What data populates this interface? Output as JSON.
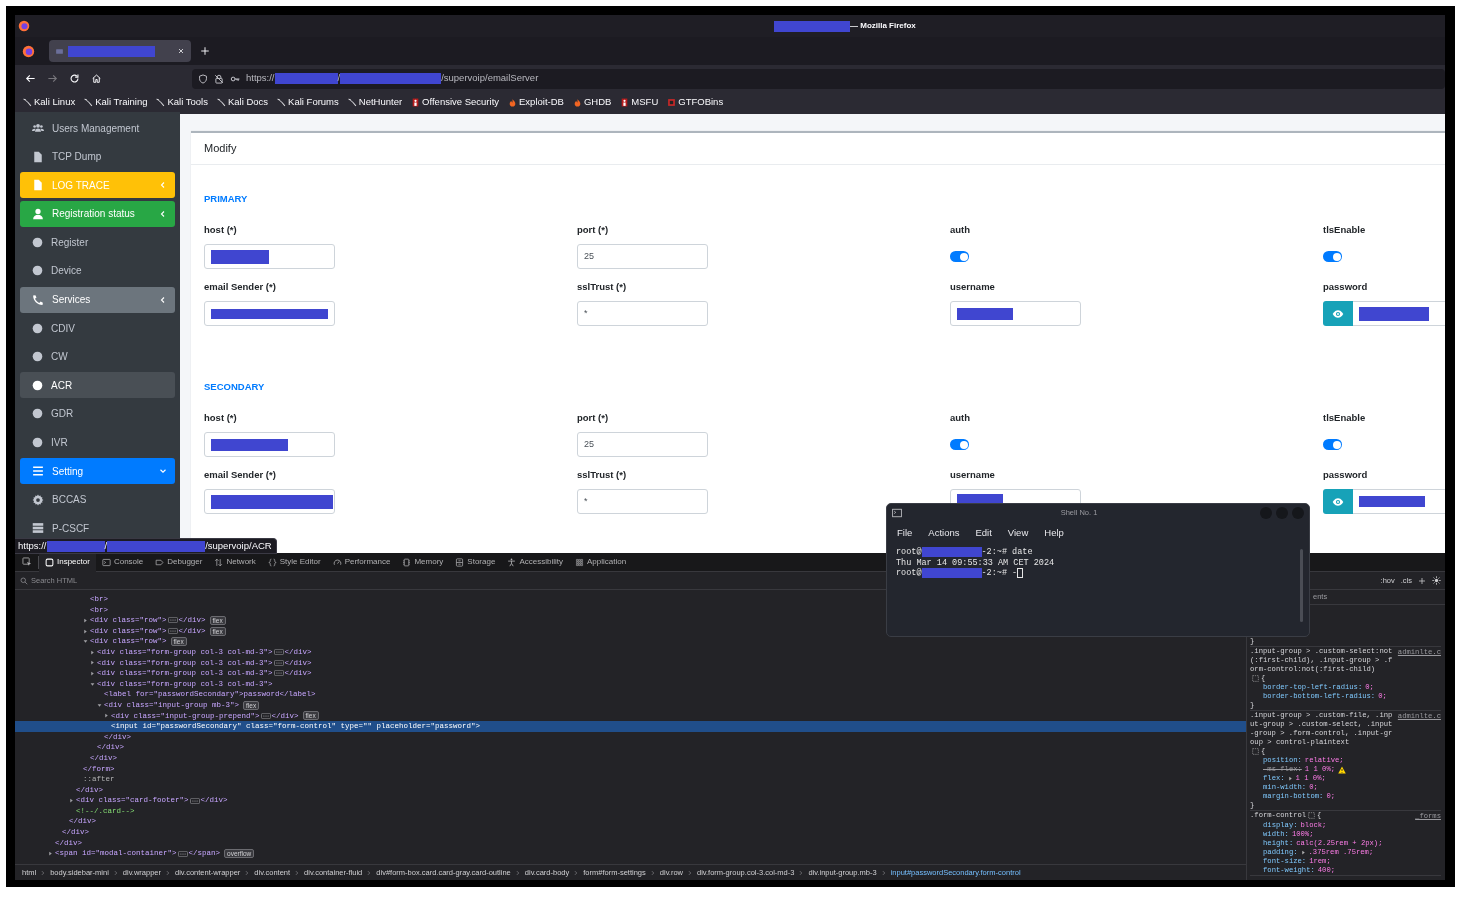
{
  "browser": {
    "title": {
      "parts": [
        {
          "kind": "redacted"
        },
        {
          "kind": "text",
          "text": "— Mozilla Firefox"
        }
      ]
    },
    "tabs": [
      {
        "parts": [
          {
            "kind": "redacted"
          }
        ],
        "selected": true
      }
    ],
    "url": {
      "parts": [
        {
          "kind": "text",
          "text": "https://"
        },
        {
          "kind": "redacted"
        },
        {
          "kind": "text",
          "text": "/"
        },
        {
          "kind": "redacted"
        },
        {
          "kind": "text",
          "text": "/supervoip/emailServer"
        }
      ]
    },
    "bookmarks": [
      "Kali Linux",
      "Kali Training",
      "Kali Tools",
      "Kali Docs",
      "Kali Forums",
      "NetHunter",
      "Offensive Security",
      "Exploit-DB",
      "GHDB",
      "MSFU",
      "GTFOBins"
    ]
  },
  "sidebar": {
    "items": [
      {
        "label": "Users Management",
        "kind": "link",
        "selected": false
      },
      {
        "label": "TCP Dump",
        "kind": "link",
        "selected": false
      },
      {
        "label": "LOG TRACE",
        "kind": "menu",
        "expanded": false,
        "selected": false
      },
      {
        "label": "Registration status",
        "kind": "menu",
        "expanded": false,
        "selected": false
      },
      {
        "label": "Register",
        "kind": "sub",
        "selected": false
      },
      {
        "label": "Device",
        "kind": "sub",
        "selected": false
      },
      {
        "label": "Services",
        "kind": "menu",
        "expanded": false,
        "selected": false
      },
      {
        "label": "CDIV",
        "kind": "sub",
        "selected": false
      },
      {
        "label": "CW",
        "kind": "sub",
        "selected": false
      },
      {
        "label": "ACR",
        "kind": "sub",
        "selected": true
      },
      {
        "label": "GDR",
        "kind": "sub",
        "selected": false
      },
      {
        "label": "IVR",
        "kind": "sub",
        "selected": false
      },
      {
        "label": "Setting",
        "kind": "menu",
        "expanded": true,
        "selected": false
      },
      {
        "label": "BCCAS",
        "kind": "link",
        "selected": false
      },
      {
        "label": "P-CSCF",
        "kind": "link",
        "selected": false
      }
    ]
  },
  "form": {
    "header": "Modify",
    "sections": [
      {
        "title": "PRIMARY",
        "fields": [
          {
            "label": "host (*)",
            "kind": "text",
            "redacted": true
          },
          {
            "label": "port (*)",
            "kind": "text",
            "redacted": false,
            "value": "25"
          },
          {
            "label": "auth",
            "kind": "switch",
            "on": true
          },
          {
            "label": "tlsEnable",
            "kind": "switch",
            "on": true
          },
          {
            "label": "email Sender (*)",
            "kind": "text",
            "redacted": true
          },
          {
            "label": "sslTrust (*)",
            "kind": "text",
            "redacted": false,
            "value": "*"
          },
          {
            "label": "username",
            "kind": "text",
            "redacted": true
          },
          {
            "label": "password",
            "kind": "password",
            "redacted": true
          }
        ]
      },
      {
        "title": "SECONDARY",
        "fields": [
          {
            "label": "host (*)",
            "kind": "text",
            "redacted": true
          },
          {
            "label": "port (*)",
            "kind": "text",
            "redacted": false,
            "value": "25"
          },
          {
            "label": "auth",
            "kind": "switch",
            "on": true
          },
          {
            "label": "tlsEnable",
            "kind": "switch",
            "on": true
          },
          {
            "label": "email Sender (*)",
            "kind": "text",
            "redacted": true
          },
          {
            "label": "sslTrust (*)",
            "kind": "text",
            "redacted": false,
            "value": "*"
          },
          {
            "label": "username",
            "kind": "text",
            "redacted": true
          },
          {
            "label": "password",
            "kind": "password",
            "redacted": true
          }
        ]
      }
    ]
  },
  "link_preview": {
    "parts": [
      {
        "kind": "text",
        "text": "https://"
      },
      {
        "kind": "redacted"
      },
      {
        "kind": "text",
        "text": "/"
      },
      {
        "kind": "redacted"
      },
      {
        "kind": "text",
        "text": "/supervoip/ACR"
      }
    ]
  },
  "devtools": {
    "tabs": [
      {
        "label": "Inspector",
        "selected": true
      },
      {
        "label": "Console",
        "selected": false
      },
      {
        "label": "Debugger",
        "selected": false
      },
      {
        "label": "Network",
        "selected": false
      },
      {
        "label": "Style Editor",
        "selected": false
      },
      {
        "label": "Performance",
        "selected": false
      },
      {
        "label": "Memory",
        "selected": false
      },
      {
        "label": "Storage",
        "selected": false
      },
      {
        "label": "Accessibility",
        "selected": false
      },
      {
        "label": "Application",
        "selected": false
      }
    ],
    "search": {
      "placeholder": "Search HTML"
    },
    "tree": [
      {
        "close": "</div>",
        "children": [
          {
            "close": "</div>",
            "children": [
              {
                "close": "</div>",
                "children": [
                  {
                    "close": "</div>",
                    "children": [
                      {
                        "close": "</form>",
                        "children": [
                          {
                            "text": "<br>",
                            "kind": "tag",
                            "selected": false
                          },
                          {
                            "text": "<br>",
                            "kind": "tag",
                            "selected": false
                          },
                          {
                            "open": "<div class=\"row\">",
                            "close": "</div>",
                            "badge": "flex",
                            "expanded": false,
                            "selected": false
                          },
                          {
                            "open": "<div class=\"row\">",
                            "close": "</div>",
                            "badge": "flex",
                            "expanded": false,
                            "selected": false
                          },
                          {
                            "open": "<div class=\"row\">",
                            "close": "</div>",
                            "badge": "flex",
                            "expanded": true,
                            "selected": false,
                            "children": [
                              {
                                "open": "<div class=\"form-group col-3 col-md-3\">",
                                "close": "</div>",
                                "expanded": false,
                                "selected": false
                              },
                              {
                                "open": "<div class=\"form-group col-3 col-md-3\">",
                                "close": "</div>",
                                "expanded": false,
                                "selected": false
                              },
                              {
                                "open": "<div class=\"form-group col-3 col-md-3\">",
                                "close": "</div>",
                                "expanded": false,
                                "selected": false
                              },
                              {
                                "open": "<div class=\"form-group col-3 col-md-3\">",
                                "close": "</div>",
                                "expanded": true,
                                "selected": false,
                                "children": [
                                  {
                                    "text": "<label for=\"passwordSecondary\">password</label>",
                                    "kind": "tag",
                                    "selected": false
                                  },
                                  {
                                    "open": "<div class=\"input-group mb-3\">",
                                    "close": "</div>",
                                    "badge": "flex",
                                    "expanded": true,
                                    "selected": false,
                                    "children": [
                                      {
                                        "open": "<div class=\"input-group-prepend\">",
                                        "close": "</div>",
                                        "badge": "flex",
                                        "expanded": false,
                                        "selected": false
                                      },
                                      {
                                        "text": "<input id=\"passwordSecondary\" class=\"form-control\" type=\"\" placeholder=\"password\">",
                                        "kind": "tag",
                                        "selected": true
                                      }
                                    ]
                                  }
                                ]
                              }
                            ]
                          }
                        ]
                      },
                      {
                        "text": "::after",
                        "kind": "pseudo",
                        "selected": false
                      }
                    ]
                  },
                  {
                    "open": "<div class=\"card-footer\">",
                    "close": "</div>",
                    "expanded": false,
                    "selected": false
                  },
                  {
                    "text": "<!--/.card-->",
                    "kind": "comment",
                    "selected": false
                  }
                ]
              }
            ]
          }
        ]
      },
      {
        "open": "<span id=\"modal-container\">",
        "close": "</span>",
        "badge": "overflow",
        "expanded": false,
        "selected": false
      }
    ],
    "breadcrumb": [
      {
        "label": "html",
        "selected": false
      },
      {
        "label": "body.sidebar-mini",
        "selected": false
      },
      {
        "label": "div.wrapper",
        "selected": false
      },
      {
        "label": "div.content-wrapper",
        "selected": false
      },
      {
        "label": "div.content",
        "selected": false
      },
      {
        "label": "div.container-fluid",
        "selected": false
      },
      {
        "label": "div#form-box.card.card-gray.card-outline",
        "selected": false
      },
      {
        "label": "div.card-body",
        "selected": false
      },
      {
        "label": "form#form-settings",
        "selected": false
      },
      {
        "label": "div.row",
        "selected": false
      },
      {
        "label": "div.form-group.col-3.col-md-3",
        "selected": false
      },
      {
        "label": "div.input-group.mb-3",
        "selected": false
      },
      {
        "label": "input#passwordSecondary.form-control",
        "selected": true
      }
    ],
    "rules_panel": {
      "toolbar_buttons": [
        ":hov",
        ".cls"
      ],
      "tab_fragment": "ents",
      "rules": [
        {
          "close": "}"
        },
        {
          "selector": ".input-group > .custom-select:not(:first-child), .input-group > .form-control:not(:first-child)",
          "open": "{",
          "source": "adminlte.c",
          "close": "}",
          "declarations": [
            {
              "name": "border-top-left-radius:",
              "value": "0;",
              "overridden": false,
              "expandable": false,
              "warning": false
            },
            {
              "name": "border-bottom-left-radius:",
              "value": "0;",
              "overridden": false,
              "expandable": false,
              "warning": false
            }
          ]
        },
        {
          "selector": ".input-group > .custom-file, .input-group > .custom-select, .input-group > .form-control, .input-group > control-plaintext",
          "open": "{",
          "source": "adminlte.c",
          "close": "}",
          "declarations": [
            {
              "name": "position:",
              "value": "relative;",
              "overridden": false,
              "expandable": false,
              "warning": false
            },
            {
              "name": "-ms-flex:",
              "value": "1 1 0%;",
              "overridden": true,
              "expandable": false,
              "warning": true
            },
            {
              "name": "flex:",
              "value": "1 1 0%;",
              "overridden": false,
              "expandable": true,
              "warning": false
            },
            {
              "name": "min-width:",
              "value": "0;",
              "overridden": false,
              "expandable": false,
              "warning": false
            },
            {
              "name": "margin-bottom:",
              "value": "0;",
              "overridden": false,
              "expandable": false,
              "warning": false
            }
          ]
        },
        {
          "selector": ".form-control",
          "open": "{",
          "source": "_forms",
          "declarations": [
            {
              "name": "display:",
              "value": "block;",
              "overridden": false,
              "expandable": false,
              "warning": false
            },
            {
              "name": "width:",
              "value": "100%;",
              "overridden": false,
              "expandable": false,
              "warning": false
            },
            {
              "name": "height:",
              "value": "calc(2.25rem + 2px);",
              "overridden": false,
              "expandable": false,
              "warning": false
            },
            {
              "name": "padding:",
              "value": ".375rem .75rem;",
              "overridden": false,
              "expandable": true,
              "warning": false
            },
            {
              "name": "font-size:",
              "value": "1rem;",
              "overridden": false,
              "expandable": false,
              "warning": false
            },
            {
              "name": "font-weight:",
              "value": "400;",
              "overridden": false,
              "expandable": false,
              "warning": false
            }
          ]
        }
      ]
    }
  },
  "terminal": {
    "title": "Shell No. 1",
    "menu": [
      "File",
      "Actions",
      "Edit",
      "View",
      "Help"
    ],
    "lines": [
      {
        "parts": [
          {
            "kind": "text",
            "text": "root@"
          },
          {
            "kind": "redacted"
          },
          {
            "kind": "text",
            "text": "-2:~# date"
          }
        ],
        "cursor": false
      },
      {
        "parts": [
          {
            "kind": "text",
            "text": "Thu Mar 14 09:55:33 AM CET 2024"
          }
        ],
        "cursor": false
      },
      {
        "parts": [
          {
            "kind": "text",
            "text": "root@"
          },
          {
            "kind": "redacted"
          },
          {
            "kind": "text",
            "text": "-2:~# -"
          }
        ],
        "cursor": true
      }
    ]
  }
}
